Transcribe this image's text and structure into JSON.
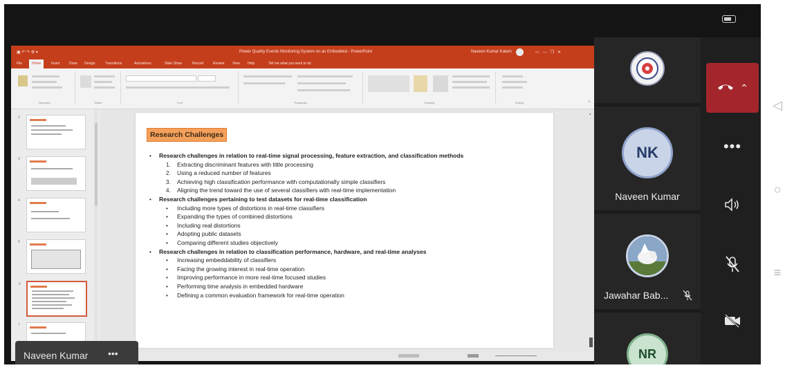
{
  "app": {
    "window_title": "Power Quality Events Monitoring System on an Embedded - PowerPoint",
    "user_name": "Naveen Kumar Kalam",
    "search_hint": "Tell me what you want to do",
    "menu": [
      "File",
      "Home",
      "Insert",
      "Draw",
      "Design",
      "Transitions",
      "Animations",
      "Slide Show",
      "Record",
      "Review",
      "View",
      "Help"
    ],
    "active_menu": "Home",
    "ribbon_groups": [
      "Clipboard",
      "Slides",
      "Font",
      "Paragraph",
      "Drawing",
      "Editing"
    ]
  },
  "thumbnails": [
    {
      "num": "2",
      "selected": false
    },
    {
      "num": "3",
      "selected": false
    },
    {
      "num": "4",
      "selected": false
    },
    {
      "num": "5",
      "selected": false
    },
    {
      "num": "6",
      "selected": true
    },
    {
      "num": "7",
      "selected": false
    }
  ],
  "slide": {
    "title": "Research Challenges",
    "lines": [
      {
        "text": "Research challenges in relation to real-time signal processing, feature extraction, and classification methods",
        "level": 0,
        "bold": true,
        "marker": "•"
      },
      {
        "text": "Extracting discriminant features with little processing",
        "level": 1,
        "bold": false,
        "marker": "1."
      },
      {
        "text": "Using a reduced number of features",
        "level": 1,
        "bold": false,
        "marker": "2."
      },
      {
        "text": "Achieving high classification performance with computationally simple classifiers",
        "level": 1,
        "bold": false,
        "marker": "3."
      },
      {
        "text": "Aligning the trend toward the use of several classifiers with real-time implementation",
        "level": 1,
        "bold": false,
        "marker": "4."
      },
      {
        "text": "Research challenges pertaining to test datasets for real-time classification",
        "level": 0,
        "bold": true,
        "marker": "•"
      },
      {
        "text": "Including more types of distortions in real-time classifiers",
        "level": 1,
        "bold": false,
        "marker": "•"
      },
      {
        "text": "Expanding the types of combined distortions",
        "level": 1,
        "bold": false,
        "marker": "•"
      },
      {
        "text": "Including real distortions",
        "level": 1,
        "bold": false,
        "marker": "•"
      },
      {
        "text": "Adopting public datasets",
        "level": 1,
        "bold": false,
        "marker": "•"
      },
      {
        "text": "Comparing different studies objectively",
        "level": 1,
        "bold": false,
        "marker": "•"
      },
      {
        "text": "Research challenges in relation to classification performance, hardware, and real-time analyses",
        "level": 0,
        "bold": true,
        "marker": "•"
      },
      {
        "text": "Increasing embeddability of classifiers",
        "level": 1,
        "bold": false,
        "marker": "•"
      },
      {
        "text": "Facing the growing interest in real-time operation",
        "level": 1,
        "bold": false,
        "marker": "•"
      },
      {
        "text": "Improving performance in more real-time focused studies",
        "level": 1,
        "bold": false,
        "marker": "•"
      },
      {
        "text": "Performing time analysis in embedded hardware",
        "level": 1,
        "bold": false,
        "marker": "•"
      },
      {
        "text": "Defining a common evaluation framework for real-time operation",
        "level": 1,
        "bold": false,
        "marker": "•"
      }
    ]
  },
  "participants": [
    {
      "initials": "",
      "name": "",
      "kind": "logo"
    },
    {
      "initials": "NK",
      "name": "Naveen Kumar",
      "kind": "initials"
    },
    {
      "initials": "",
      "name": "Jawahar Bab...",
      "kind": "photo",
      "muted": true
    },
    {
      "initials": "NR",
      "name": "",
      "kind": "initials"
    }
  ],
  "presenter": {
    "name": "Naveen Kumar",
    "more": "•••"
  },
  "controls": {
    "more": "•••"
  },
  "colors": {
    "ppt_accent": "#c43e1c",
    "end_call": "#a4262c",
    "title_box": "#f5a05a"
  }
}
